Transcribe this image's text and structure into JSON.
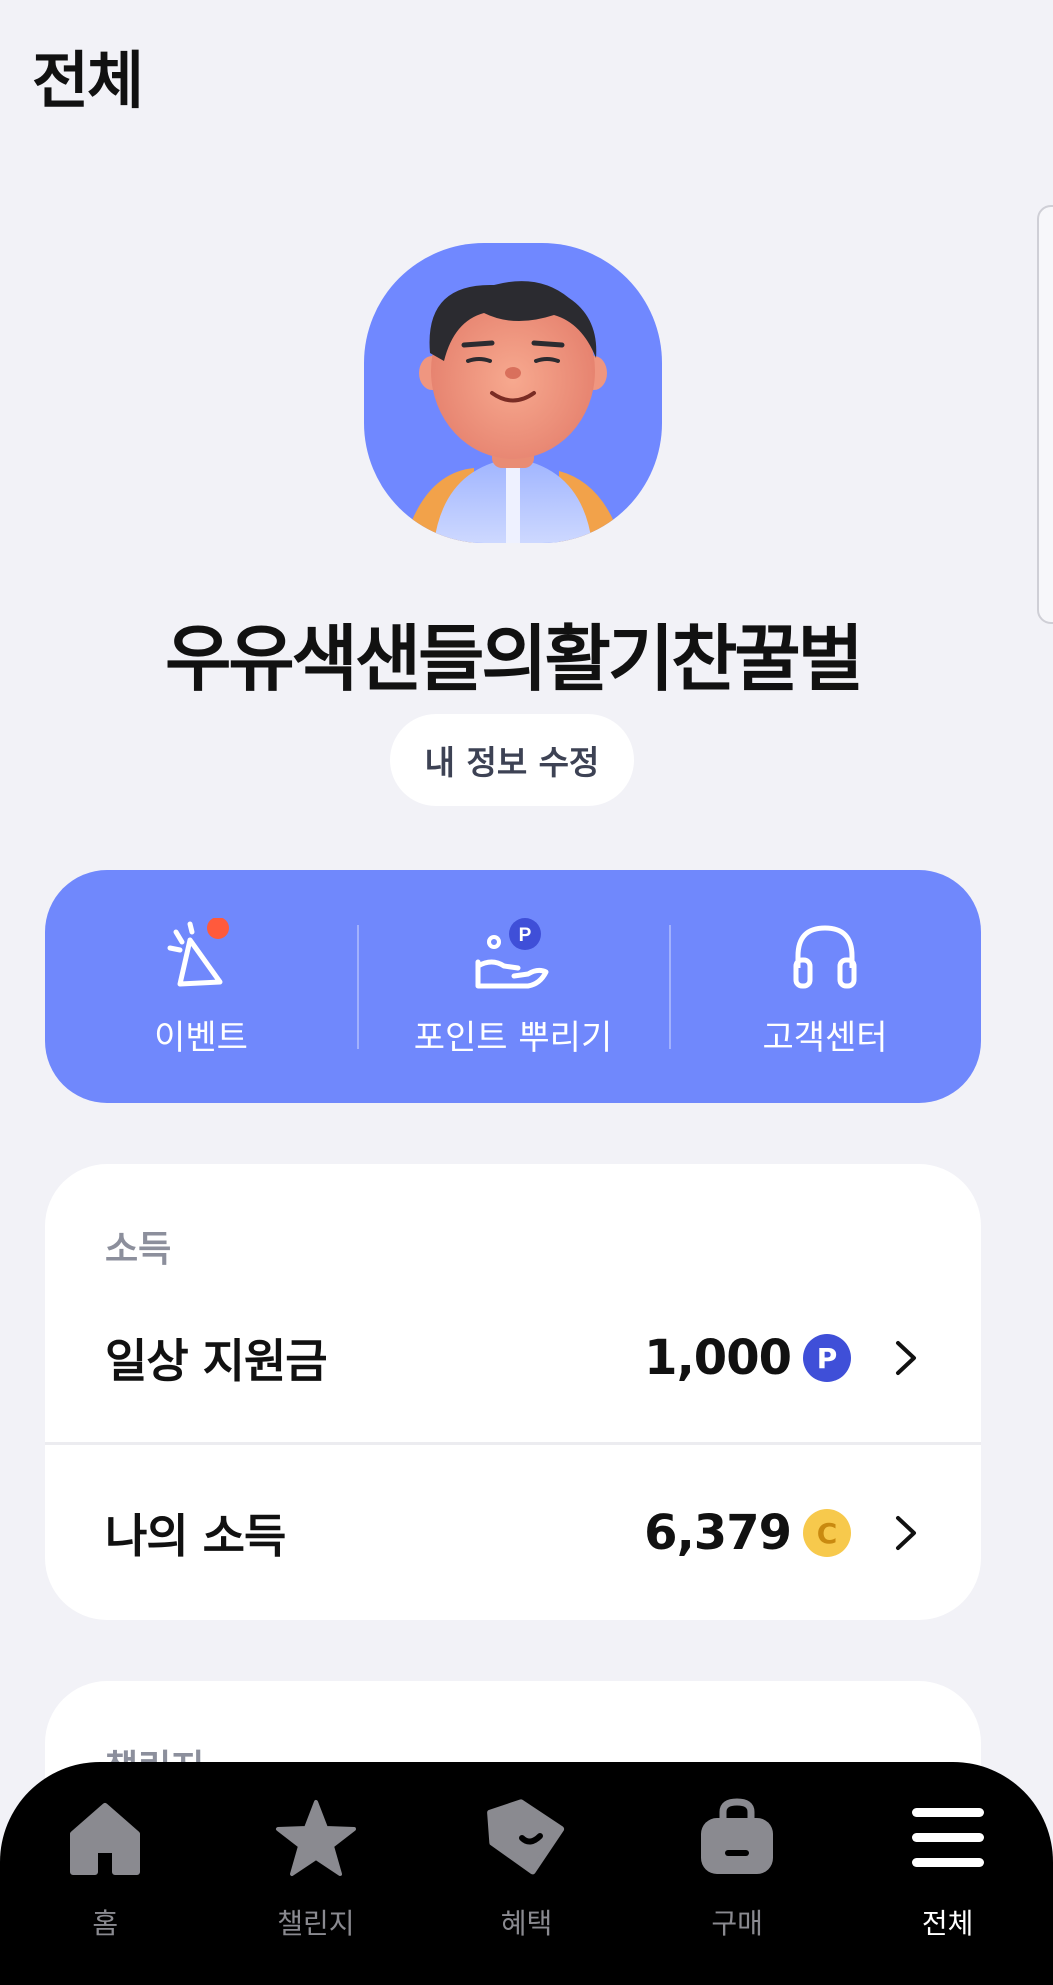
{
  "header": {
    "title": "전체"
  },
  "profile": {
    "username": "우유색샌들의활기찬꿀벌",
    "edit_label": "내 정보 수정"
  },
  "quick_menu": {
    "items": [
      {
        "label": "이벤트",
        "icon": "party-popper-icon"
      },
      {
        "label": "포인트 뿌리기",
        "icon": "hand-point-icon"
      },
      {
        "label": "고객센터",
        "icon": "headset-icon"
      }
    ]
  },
  "income": {
    "section_label": "소득",
    "rows": [
      {
        "name": "일상 지원금",
        "amount": "1,000",
        "badge": "P"
      },
      {
        "name": "나의 소득",
        "amount": "6,379",
        "badge": "C"
      }
    ]
  },
  "challenge": {
    "section_label": "챌린지"
  },
  "bottom_nav": {
    "items": [
      {
        "label": "홈",
        "icon": "home-icon",
        "active": false
      },
      {
        "label": "챌린지",
        "icon": "star-icon",
        "active": false
      },
      {
        "label": "혜택",
        "icon": "tag-icon",
        "active": false
      },
      {
        "label": "구매",
        "icon": "bag-icon",
        "active": false
      },
      {
        "label": "전체",
        "icon": "menu-icon",
        "active": true
      }
    ]
  },
  "colors": {
    "background": "#f2f2f7",
    "accent": "#7088fc",
    "point_badge": "#3f4fd8",
    "coin_badge": "#f7c94c",
    "notification_dot": "#ff5a3c",
    "nav_background": "#000000"
  }
}
